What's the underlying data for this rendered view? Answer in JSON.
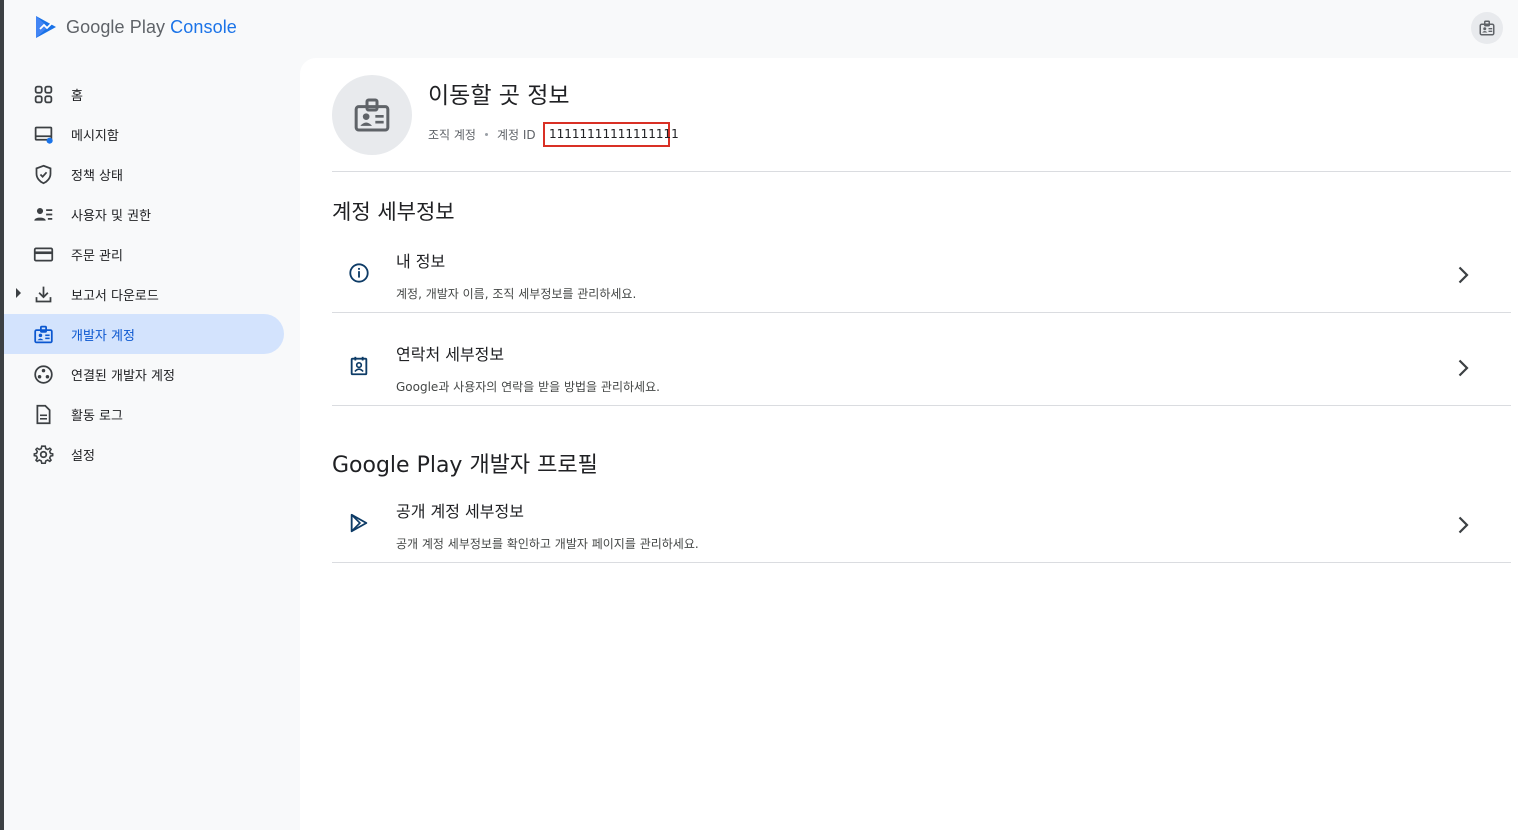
{
  "brand": {
    "name_part1": "Google Play",
    "name_part2": "Console"
  },
  "sidebar": {
    "items": [
      {
        "label": "홈",
        "icon": "dashboard-icon"
      },
      {
        "label": "메시지함",
        "icon": "inbox-icon"
      },
      {
        "label": "정책 상태",
        "icon": "shield-icon"
      },
      {
        "label": "사용자 및 권한",
        "icon": "users-icon"
      },
      {
        "label": "주문 관리",
        "icon": "credit-card-icon"
      },
      {
        "label": "보고서 다운로드",
        "icon": "download-icon"
      },
      {
        "label": "개발자 계정",
        "icon": "badge-icon"
      },
      {
        "label": "연결된 개발자 계정",
        "icon": "linked-accounts-icon"
      },
      {
        "label": "활동 로그",
        "icon": "document-icon"
      },
      {
        "label": "설정",
        "icon": "gear-icon"
      }
    ],
    "active_index": 6
  },
  "header": {
    "title": "이동할 곳 정보",
    "account_type": "조직 계정",
    "account_id_label": "계정 ID",
    "account_id_value": "11111111111111111"
  },
  "sections": {
    "account_details": {
      "title": "계정 세부정보",
      "rows": [
        {
          "title": "내 정보",
          "description": "계정, 개발자 이름, 조직 세부정보를 관리하세요.",
          "icon": "info-icon"
        },
        {
          "title": "연락처 세부정보",
          "description": "Google과 사용자의 연락을 받을 방법을 관리하세요.",
          "icon": "contact-card-icon"
        }
      ]
    },
    "developer_profile": {
      "title": "Google Play 개발자 프로필",
      "rows": [
        {
          "title": "공개 계정 세부정보",
          "description": "공개 계정 세부정보를 확인하고 개발자 페이지를 관리하세요.",
          "icon": "play-icon"
        }
      ]
    }
  },
  "colors": {
    "accent": "#1a73e8",
    "active_nav_bg": "#d3e3fd",
    "highlight_box": "#d93025"
  }
}
